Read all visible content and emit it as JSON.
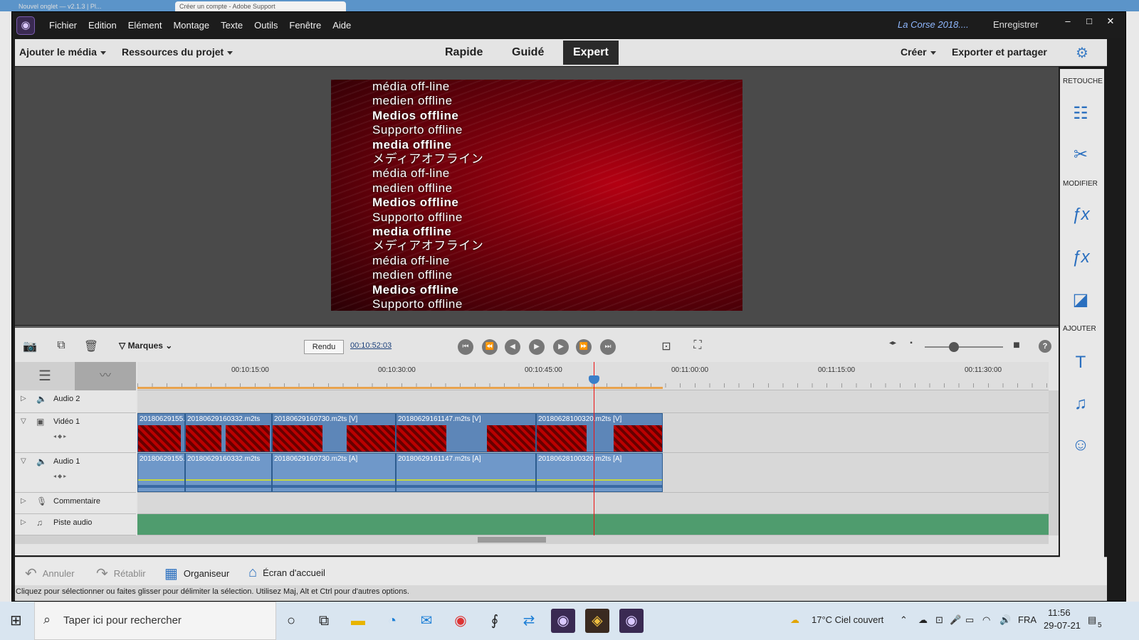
{
  "browser_tabs": [
    "Nouvel onglet — v2.1.3 | Pl...",
    "Créer un compte - Adobe Support"
  ],
  "app": {
    "menu": [
      "Fichier",
      "Edition",
      "Elément",
      "Montage",
      "Texte",
      "Outils",
      "Fenêtre",
      "Aide"
    ],
    "project_name": "La Corse 2018....",
    "save_label": "Enregistrer",
    "window_controls": [
      "–",
      "□",
      "✕"
    ]
  },
  "topbar": {
    "add_media": "Ajouter le média",
    "project_assets": "Ressources du projet",
    "modes": [
      "Rapide",
      "Guidé",
      "Expert"
    ],
    "active_mode": "Expert",
    "create": "Créer",
    "export": "Exporter et partager"
  },
  "monitor": {
    "offline_lines": [
      {
        "text": "média off-line",
        "bold": false
      },
      {
        "text": "medien offline",
        "bold": false
      },
      {
        "text": "Medios offline",
        "bold": true
      },
      {
        "text": "Supporto offline",
        "bold": false
      },
      {
        "text": "media offline",
        "bold": true
      },
      {
        "text": "メディアオフライン",
        "bold": false
      },
      {
        "text": "média off-line",
        "bold": false
      },
      {
        "text": "medien offline",
        "bold": false
      },
      {
        "text": "Medios offline",
        "bold": true
      },
      {
        "text": "Supporto offline",
        "bold": false
      },
      {
        "text": "media offline",
        "bold": true
      },
      {
        "text": "メディアオフライン",
        "bold": false
      },
      {
        "text": "média off-line",
        "bold": false
      },
      {
        "text": "medien offline",
        "bold": false
      },
      {
        "text": "Medios offline",
        "bold": true
      },
      {
        "text": "Supporto offline",
        "bold": false
      }
    ]
  },
  "timeline": {
    "markers_label": "Marques",
    "render_label": "Rendu",
    "timecode": "00:10:52:03",
    "ruler_ticks": [
      "00:10:15:00",
      "00:10:30:00",
      "00:10:45:00",
      "00:11:00:00",
      "00:11:15:00",
      "00:11:30:00"
    ],
    "tracks": {
      "audio2": "Audio 2",
      "video1": "Vidéo 1",
      "audio1": "Audio 1",
      "narration": "Commentaire",
      "soundtrack": "Piste audio"
    },
    "video_clips": [
      "20180629155...",
      "20180629160332.m2ts",
      "20180629160730.m2ts [V]",
      "20180629161147.m2ts [V]",
      "20180628100320.m2ts [V]"
    ],
    "audio_clips": [
      "20180629155...",
      "20180629160332.m2ts",
      "20180629160730.m2ts [A]",
      "20180629161147.m2ts [A]",
      "20180628100320.m2ts [A]"
    ]
  },
  "bottombar": {
    "undo": "Annuler",
    "redo": "Rétablir",
    "organizer": "Organiseur",
    "home": "Écran d'accueil"
  },
  "status_text": "Cliquez pour sélectionner ou faites glisser pour délimiter la sélection. Utilisez Maj, Alt et Ctrl pour d'autres options.",
  "rightpanel": {
    "retouch": "RETOUCHE",
    "modify": "MODIFIER",
    "add": "AJOUTER"
  },
  "taskbar": {
    "search_placeholder": "Taper ici pour rechercher",
    "weather": "17°C  Ciel couvert",
    "lang": "FRA",
    "time": "11:56",
    "date": "29-07-21",
    "notif_count": "5"
  }
}
